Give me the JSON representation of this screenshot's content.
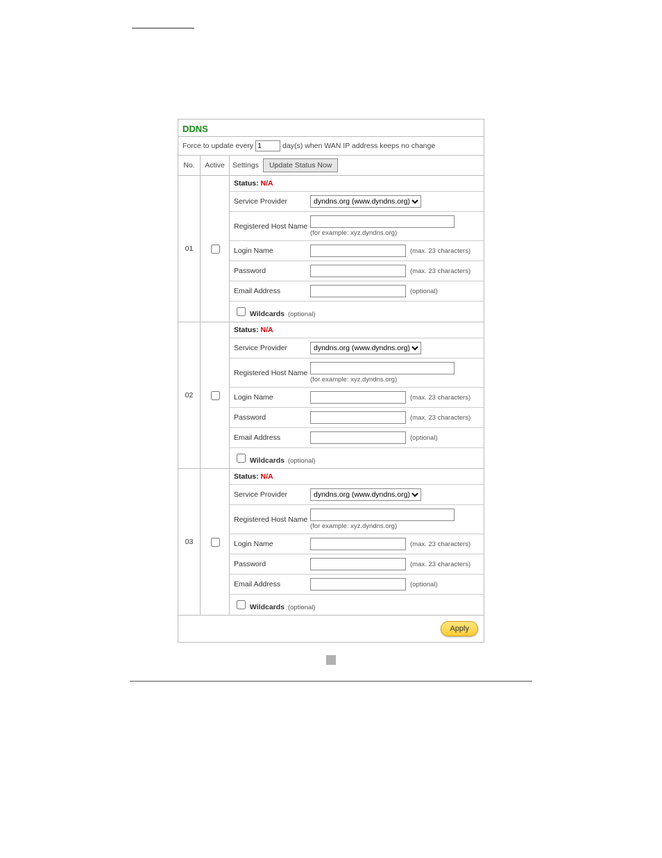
{
  "panel": {
    "title": "DDNS",
    "force_prefix": "Force to update every",
    "force_value": "1",
    "force_suffix": "day(s) when WAN IP address keeps no change",
    "col_no": "No.",
    "col_active": "Active",
    "col_settings": "Settings",
    "update_btn": "Update Status Now",
    "apply_btn": "Apply"
  },
  "labels": {
    "status": "Status:",
    "provider": "Service Provider",
    "hostname": "Registered Host Name",
    "hostname_hint": "(for example: xyz.dyndns.org)",
    "login": "Login Name",
    "login_hint": "(max. 23 characters)",
    "password": "Password",
    "password_hint": "(max. 23 characters)",
    "email": "Email Address",
    "email_hint": "(optional)",
    "wildcards": "Wildcards",
    "wildcards_hint": "(optional)"
  },
  "entries": [
    {
      "no": "01",
      "status": "N/A",
      "provider": "dyndns.org (www.dyndns.org)"
    },
    {
      "no": "02",
      "status": "N/A",
      "provider": "dyndns.org (www.dyndns.org)"
    },
    {
      "no": "03",
      "status": "N/A",
      "provider": "dyndns.org (www.dyndns.org)"
    }
  ]
}
